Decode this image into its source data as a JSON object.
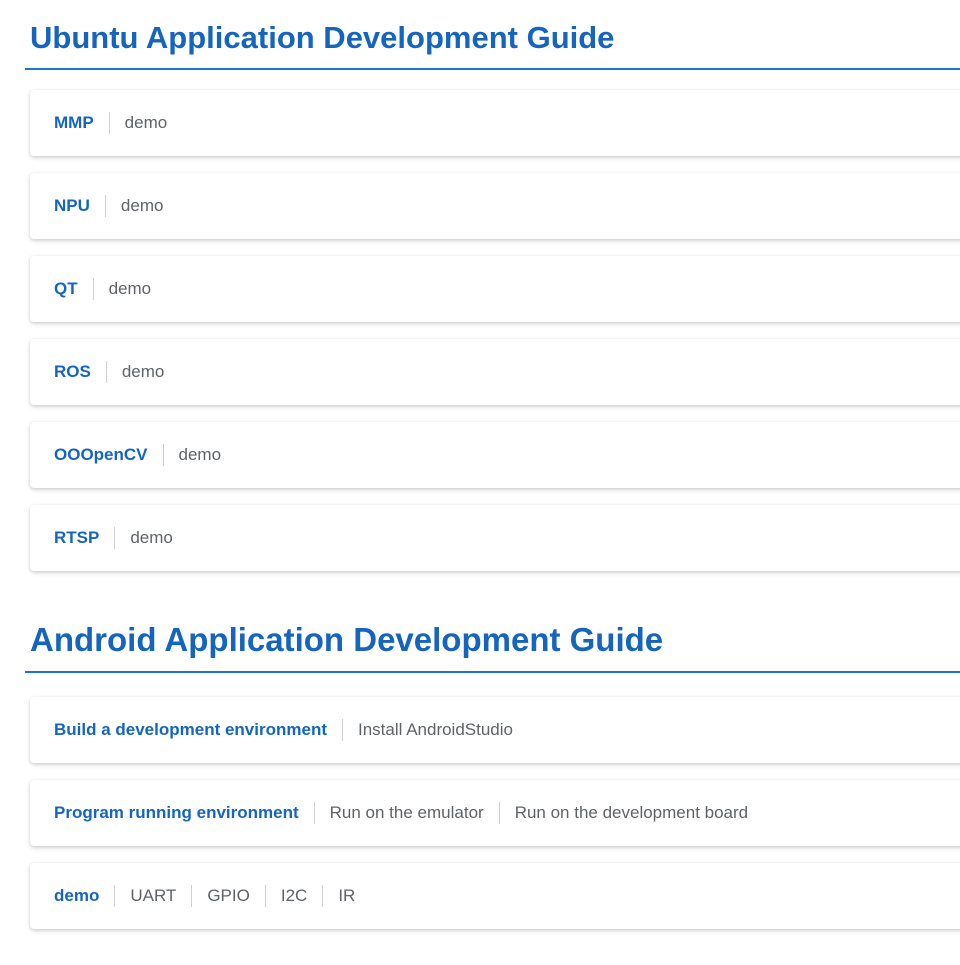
{
  "sections": [
    {
      "title": "Ubuntu Application Development Guide",
      "cards": [
        {
          "label": "MMP",
          "items": [
            "demo"
          ]
        },
        {
          "label": "NPU",
          "items": [
            "demo"
          ]
        },
        {
          "label": "QT",
          "items": [
            "demo"
          ]
        },
        {
          "label": "ROS",
          "items": [
            "demo"
          ]
        },
        {
          "label": "OOOpenCV",
          "items": [
            "demo"
          ]
        },
        {
          "label": "RTSP",
          "items": [
            "demo"
          ]
        }
      ]
    },
    {
      "title": "Android Application Development Guide",
      "cards": [
        {
          "label": "Build a development environment",
          "items": [
            "Install AndroidStudio"
          ]
        },
        {
          "label": "Program running environment",
          "items": [
            "Run on the emulator",
            "Run on the development board"
          ]
        },
        {
          "label": "demo",
          "items": [
            "UART",
            "GPIO",
            "I2C",
            "IR"
          ]
        }
      ]
    }
  ],
  "colors": {
    "accent_blue": "#1565c0",
    "rule_blue": "#1976d2",
    "item_gray": "#5f6368",
    "divider_gray": "#cfcfcf"
  }
}
